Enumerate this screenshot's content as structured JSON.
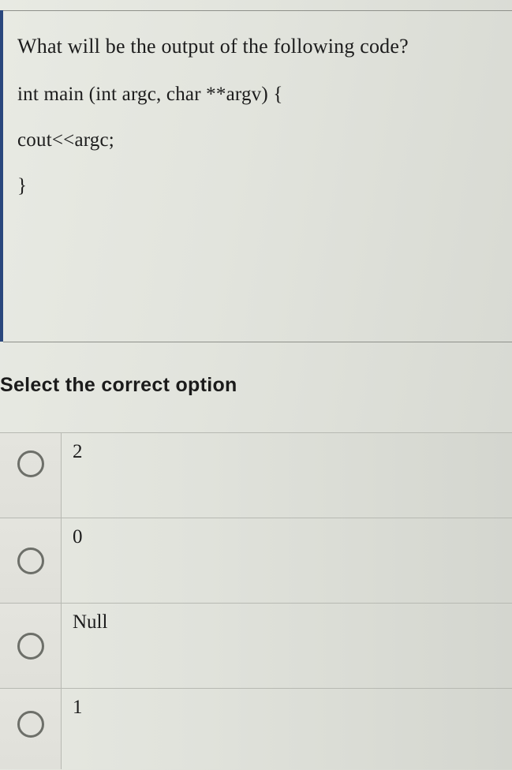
{
  "question": {
    "prompt_line": "What will be the output of the following code?",
    "code_lines": [
      "int main (int argc, char **argv) {",
      "cout<<argc;",
      "}"
    ]
  },
  "select_prompt": "Select the correct option",
  "options": [
    {
      "label": "2"
    },
    {
      "label": "0"
    },
    {
      "label": "Null"
    },
    {
      "label": "1"
    }
  ]
}
